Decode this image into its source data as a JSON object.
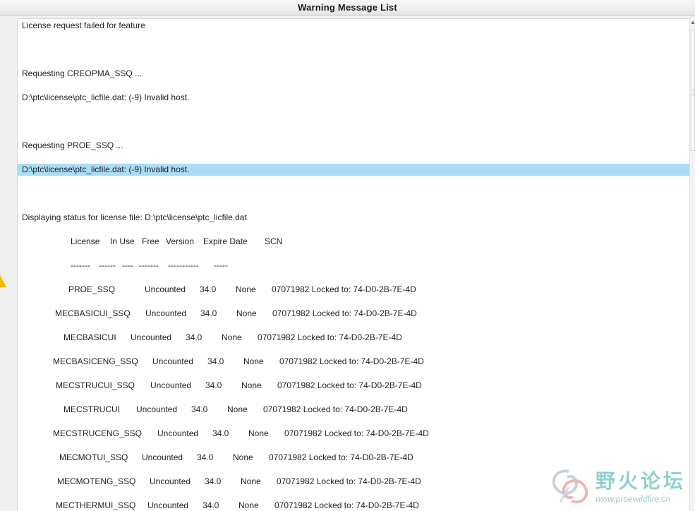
{
  "window": {
    "title": "Warning Message List"
  },
  "messages": [
    {
      "text": "License request failed for feature"
    },
    {
      "text": ""
    },
    {
      "text": "Requesting CREOPMA_SSQ ..."
    },
    {
      "text": "D:\\ptc\\license\\ptc_licfile.dat: (-9) Invalid host."
    },
    {
      "text": ""
    },
    {
      "text": "Requesting PROE_SSQ ..."
    },
    {
      "text": "D:\\ptc\\license\\ptc_licfile.dat: (-9) Invalid host.",
      "selected": true
    },
    {
      "text": ""
    },
    {
      "text": "Displaying status for license file: D:\\ptc\\license\\ptc_licfile.dat"
    }
  ],
  "license_table": {
    "headers": [
      "License",
      "In Use",
      "Free",
      "Version",
      "Expire Date",
      "SCN"
    ],
    "separators": [
      "-------",
      "------",
      "----",
      "-------",
      "-----------",
      "-----"
    ],
    "rows": [
      {
        "license": "PROE_SSQ",
        "in_use": "Uncounted",
        "version": "34.0",
        "expire": "None",
        "scn": "07071982 Locked to: 74-D0-2B-7E-4D"
      },
      {
        "license": "MECBASICUI_SSQ",
        "in_use": "Uncounted",
        "version": "34.0",
        "expire": "None",
        "scn": "07071982 Locked to: 74-D0-2B-7E-4D"
      },
      {
        "license": "MECBASICUI",
        "in_use": "Uncounted",
        "version": "34.0",
        "expire": "None",
        "scn": "07071982 Locked to: 74-D0-2B-7E-4D"
      },
      {
        "license": "MECBASICENG_SSQ",
        "in_use": "Uncounted",
        "version": "34.0",
        "expire": "None",
        "scn": "07071982 Locked to: 74-D0-2B-7E-4D"
      },
      {
        "license": "MECSTRUCUI_SSQ",
        "in_use": "Uncounted",
        "version": "34.0",
        "expire": "None",
        "scn": "07071982 Locked to: 74-D0-2B-7E-4D"
      },
      {
        "license": "MECSTRUCUI",
        "in_use": "Uncounted",
        "version": "34.0",
        "expire": "None",
        "scn": "07071982 Locked to: 74-D0-2B-7E-4D"
      },
      {
        "license": "MECSTRUCENG_SSQ",
        "in_use": "Uncounted",
        "version": "34.0",
        "expire": "None",
        "scn": "07071982 Locked to: 74-D0-2B-7E-4D"
      },
      {
        "license": "MECMOTUI_SSQ",
        "in_use": "Uncounted",
        "version": "34.0",
        "expire": "None",
        "scn": "07071982 Locked to: 74-D0-2B-7E-4D"
      },
      {
        "license": "MECMOTENG_SSQ",
        "in_use": "Uncounted",
        "version": "34.0",
        "expire": "None",
        "scn": "07071982 Locked to: 74-D0-2B-7E-4D"
      },
      {
        "license": "MECTHERMUI_SSQ",
        "in_use": "Uncounted",
        "version": "34.0",
        "expire": "None",
        "scn": "07071982 Locked to: 74-D0-2B-7E-4D"
      }
    ]
  },
  "watermark": {
    "title": "野火论坛",
    "url": "www.proewildfire.cn"
  },
  "icons": {
    "warning": "warning-icon",
    "scroll_up": "chevron-up-icon"
  },
  "colors": {
    "selection": "#aadcf7",
    "warning": "#f5b700",
    "watermark": "#7ec8c8"
  }
}
